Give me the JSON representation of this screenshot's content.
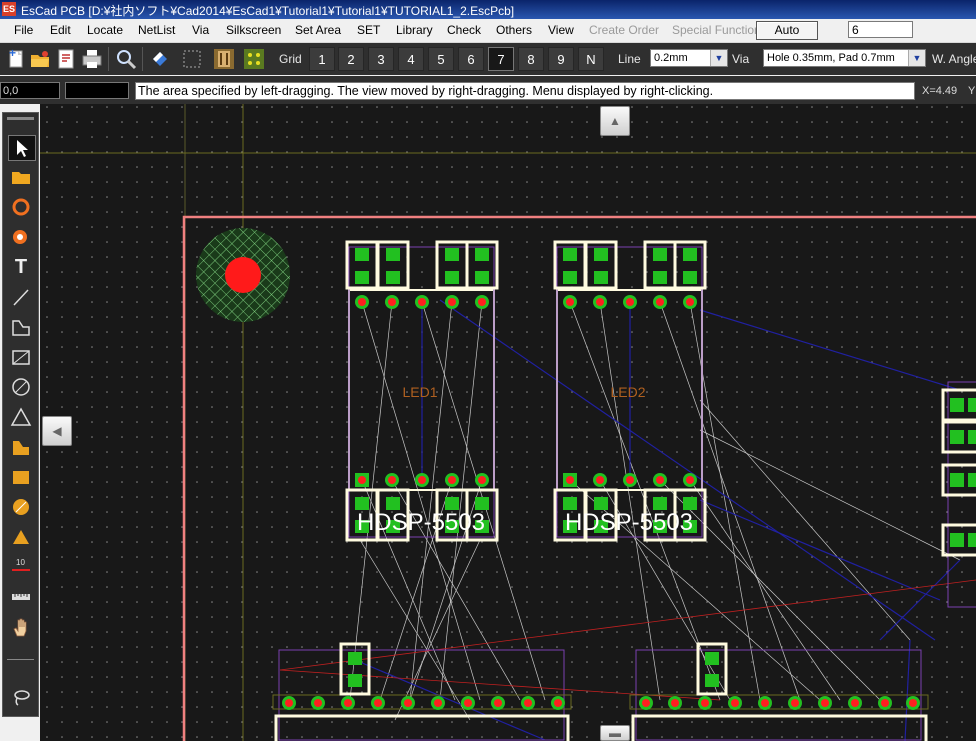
{
  "title": "EsCad PCB [D:¥社内ソフト¥Cad2014¥EsCad1¥Tutorial1¥Tutorial1¥TUTORIAL1_2.EscPcb]",
  "menu": [
    "File",
    "Edit",
    "Locate",
    "NetList",
    "Via",
    "Silkscreen",
    "Set Area",
    "SET",
    "Library",
    "Check",
    "Others",
    "View"
  ],
  "menu_disabled": [
    "Create Order",
    "Special Function"
  ],
  "auto_label": "Auto",
  "auto_value": "6",
  "toolbar": {
    "grid_label": "Grid",
    "grid_buttons": [
      "1",
      "2",
      "3",
      "4",
      "5",
      "6",
      "7",
      "8",
      "9",
      "N"
    ],
    "grid_active": "7",
    "line_label": "Line",
    "line_value": "0.2mm",
    "via_label": "Via",
    "via_value": "Hole 0.35mm, Pad 0.7mm",
    "wangle_label": "W. Angle"
  },
  "status": {
    "coord1": "0,0",
    "coord2": "",
    "message": "The area specified by left-dragging. The view moved by right-dragging. Menu displayed by right-clicking.",
    "x_readout": "X=4.49",
    "y_readout": "Y"
  },
  "tools": [
    "select-arrow",
    "open-folder",
    "circle",
    "via-pad",
    "text",
    "line",
    "polyline",
    "rectangle",
    "arc",
    "triangle",
    "fill-polygon",
    "fill-rect",
    "fill-circle",
    "fill-triangle",
    "measure-10",
    "ruler",
    "hand",
    "lasso"
  ],
  "board": {
    "components": [
      {
        "ref": "LED1",
        "part": "HDSP-5503"
      },
      {
        "ref": "LED2",
        "part": "HDSP-5503"
      }
    ]
  },
  "colors": {
    "board_outline": "#f08080",
    "silk": "#fffbe0",
    "pad_green": "#22c020",
    "via_red": "#ff2020",
    "ratsnest": "#c8c8c8",
    "trace_blue": "#2020a0",
    "ref_text": "#b06020"
  }
}
